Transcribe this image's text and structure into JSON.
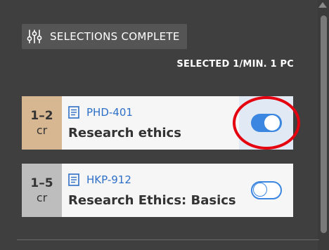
{
  "status": {
    "label": "SELECTIONS COMPLETE",
    "icon": "sliders-icon"
  },
  "selected_count": "SELECTED 1/MIN. 1 PC",
  "courses": [
    {
      "credits": "1–2",
      "unit": "cr",
      "code": "PHD-401",
      "title": "Research ethics",
      "selected": true,
      "credit_color": "#d7b791"
    },
    {
      "credits": "1–5",
      "unit": "cr",
      "code": "HKP-912",
      "title": "Research Ethics: Basics",
      "selected": false,
      "credit_color": "#bdbdbd"
    }
  ],
  "colors": {
    "background": "#3f3f3f",
    "accent": "#3a86e0",
    "link": "#2e6fc7",
    "highlight": "#e5000f"
  }
}
